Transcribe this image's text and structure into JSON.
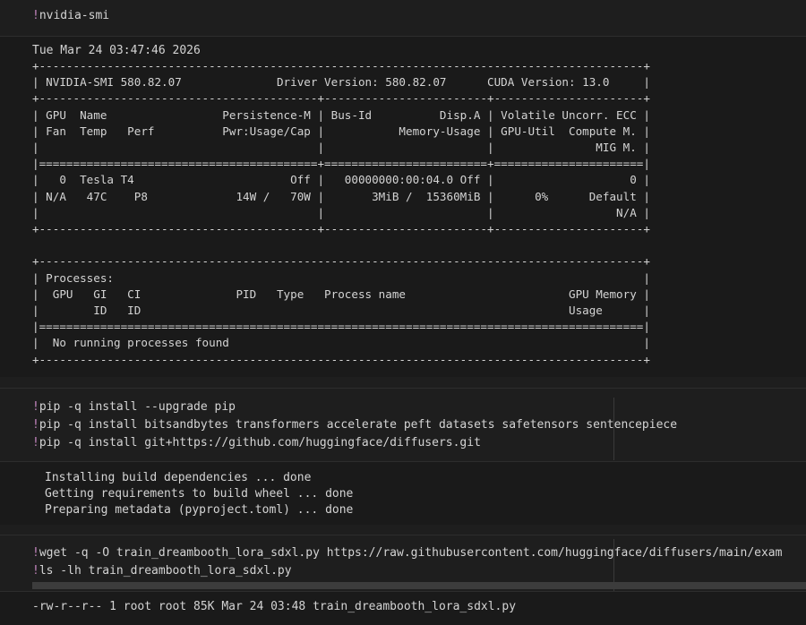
{
  "cells": {
    "cell1": {
      "bang": "!",
      "cmd": "nvidia-smi"
    },
    "output1": {
      "timestamp": "Tue Mar 24 03:47:46 2026",
      "smi_text": "+-----------------------------------------------------------------------------------------+\n| NVIDIA-SMI 580.82.07              Driver Version: 580.82.07      CUDA Version: 13.0     |\n+-----------------------------------------+------------------------+----------------------+\n| GPU  Name                 Persistence-M | Bus-Id          Disp.A | Volatile Uncorr. ECC |\n| Fan  Temp   Perf          Pwr:Usage/Cap |           Memory-Usage | GPU-Util  Compute M. |\n|                                         |                        |               MIG M. |\n|=========================================+========================+======================|\n|   0  Tesla T4                       Off |   00000000:00:04.0 Off |                    0 |\n| N/A   47C    P8             14W /   70W |       3MiB /  15360MiB |      0%      Default |\n|                                         |                        |                  N/A |\n+-----------------------------------------+------------------------+----------------------+\n\n+-----------------------------------------------------------------------------------------+\n| Processes:                                                                              |\n|  GPU   GI   CI              PID   Type   Process name                        GPU Memory |\n|        ID   ID                                                               Usage      |\n|=========================================================================================|\n|  No running processes found                                                             |\n+-----------------------------------------------------------------------------------------+"
    },
    "cell2": {
      "lines": [
        {
          "bang": "!",
          "cmd": "pip -q install --upgrade pip"
        },
        {
          "bang": "!",
          "cmd": "pip -q install bitsandbytes transformers accelerate peft datasets safetensors sentencepiece"
        },
        {
          "bang": "!",
          "cmd": "pip -q install git+https://github.com/huggingface/diffusers.git"
        }
      ]
    },
    "output2": {
      "lines": [
        "Installing build dependencies ... done",
        "Getting requirements to build wheel ... done",
        "Preparing metadata (pyproject.toml) ... done"
      ]
    },
    "cell3": {
      "lines": [
        {
          "bang": "!",
          "cmd": "wget -q -O train_dreambooth_lora_sdxl.py https://raw.githubusercontent.com/huggingface/diffusers/main/exam"
        },
        {
          "bang": "!",
          "cmd": "ls -lh train_dreambooth_lora_sdxl.py"
        }
      ]
    },
    "output3": {
      "line": "-rw-r--r-- 1 root root 85K Mar 24 03:48 train_dreambooth_lora_sdxl.py"
    }
  }
}
